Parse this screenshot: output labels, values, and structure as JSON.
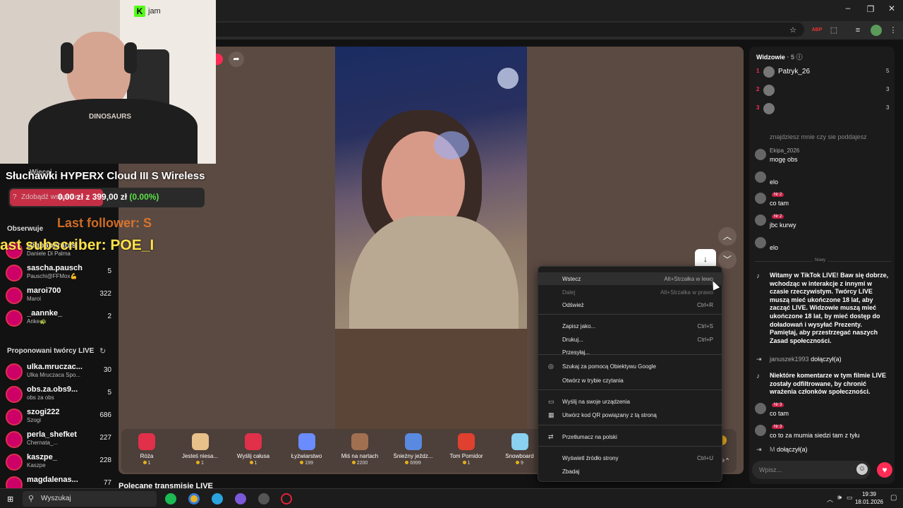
{
  "webcam": {
    "tag": "jam"
  },
  "overlay": {
    "product": "Słuchawki HYPERX Cloud III S Wireless",
    "ghost_text": "Wiecej",
    "progress_text": "0,00 zł z 399,00 zł",
    "progress_pct": "(0.00%)",
    "progress_fraction": 0.0,
    "support_button": "Zdobądź wsparcie",
    "last_follower": "Last follower: S",
    "last_subscriber": "ast subscriber: POE_I"
  },
  "sidebar": {
    "following_title": "Obserwuje",
    "following": [
      {
        "name": "Bigbabaratas",
        "sub": "Daniele Di Palma",
        "count": ""
      },
      {
        "name": "sascha.pausch",
        "sub": "Pauschi@FFMox💪",
        "count": "5"
      },
      {
        "name": "maroi700",
        "sub": "Maroi",
        "count": "322"
      },
      {
        "name": "_aannke_",
        "sub": "Anke🐢",
        "count": "2"
      }
    ],
    "suggested_title": "Proponowani twórcy LIVE",
    "suggested": [
      {
        "name": "ulka.mruczac...",
        "sub": "Ulka Mruczaca Spo...",
        "count": "30"
      },
      {
        "name": "obs.za.obs9...",
        "sub": "obs za obs",
        "count": "5"
      },
      {
        "name": "szogi222",
        "sub": "Szogi",
        "count": "686"
      },
      {
        "name": "perla_shefket",
        "sub": "Chernata_...",
        "count": "227"
      },
      {
        "name": "kaszpe_",
        "sub": "Kaszpe",
        "count": "228"
      },
      {
        "name": "magdalenas...",
        "sub": "",
        "count": "77"
      }
    ]
  },
  "page": {
    "recommended_title": "Polecane transmisje LIVE",
    "more_label": "ge ^"
  },
  "gifts": [
    {
      "name": "Róża",
      "price": "1",
      "color": "#e0304a"
    },
    {
      "name": "Jesteś niesa...",
      "price": "1",
      "color": "#e8c08a"
    },
    {
      "name": "Wyślij całusa",
      "price": "1",
      "color": "#e0304a"
    },
    {
      "name": "Łyżwiarstwo",
      "price": "199",
      "color": "#6a8cff"
    },
    {
      "name": "Miś na nartach",
      "price": "2200",
      "color": "#a07050"
    },
    {
      "name": "Śnieżny jeźdz...",
      "price": "6999",
      "color": "#5a8ae0"
    },
    {
      "name": "Tom Pomidor",
      "price": "1",
      "color": "#e04030"
    },
    {
      "name": "Snowboard",
      "price": "9",
      "color": "#8ad0f0"
    }
  ],
  "context_menu": {
    "items": [
      {
        "label": "Wstecz",
        "shortcut": "Alt+Strzałka w lewo",
        "icon": "",
        "state": "hover"
      },
      {
        "label": "Dalej",
        "shortcut": "Alt+Strzałka w prawo",
        "icon": "",
        "state": "disabled"
      },
      {
        "label": "Odśwież",
        "shortcut": "Ctrl+R",
        "icon": "",
        "state": ""
      },
      {
        "label": "Zapisz jako...",
        "shortcut": "Ctrl+S",
        "icon": "",
        "state": ""
      },
      {
        "label": "Drukuj...",
        "shortcut": "Ctrl+P",
        "icon": "",
        "state": ""
      },
      {
        "label": "Przesyłaj...",
        "shortcut": "",
        "icon": "",
        "state": ""
      },
      {
        "label": "Szukaj za pomocą Obiektywu Google",
        "shortcut": "",
        "icon": "◎",
        "state": ""
      },
      {
        "label": "Otwórz w trybie czytania",
        "shortcut": "",
        "icon": "",
        "state": ""
      },
      {
        "label": "Wyślij na swoje urządzenia",
        "shortcut": "",
        "icon": "▭",
        "state": ""
      },
      {
        "label": "Utwórz kod QR powiązany z tą stroną",
        "shortcut": "",
        "icon": "▦",
        "state": ""
      },
      {
        "label": "Przetłumacz na polski",
        "shortcut": "",
        "icon": "⇄",
        "state": ""
      },
      {
        "label": "Wyświetl źródło strony",
        "shortcut": "Ctrl+U",
        "icon": "",
        "state": ""
      },
      {
        "label": "Zbadaj",
        "shortcut": "",
        "icon": "",
        "state": ""
      }
    ]
  },
  "chat": {
    "viewers_title": "Widzowie",
    "viewers_sep": "·",
    "viewers_count": "5",
    "top_viewers": [
      {
        "rank": "1",
        "name": "Patryk_26",
        "count": "5"
      },
      {
        "rank": "2",
        "name": "",
        "count": "3"
      },
      {
        "rank": "3",
        "name": "",
        "count": "3"
      }
    ],
    "cut_text": "znajdziesz mnie czy sie poddajesz",
    "messages": [
      {
        "user": "Ekipa_2026",
        "badge": "",
        "text": "mogę obs"
      },
      {
        "user": "",
        "badge": "",
        "text": "elo"
      },
      {
        "user": "",
        "badge": "Nr 2",
        "text": "co tam"
      },
      {
        "user": "",
        "badge": "Nr 2",
        "text": "jbc kurwy"
      },
      {
        "user": "",
        "badge": "",
        "text": "elo"
      }
    ],
    "divider": "Nowy",
    "system_welcome": "Witamy w TikTok LIVE! Baw się dobrze, wchodząc w interakcje z innymi w czasie rzeczywistym. Twórcy LIVE muszą mieć ukończone 18 lat, aby zacząć LIVE. Widzowie muszą mieć ukończone 18 lat, by mieć dostęp do doładowań i wysyłać Prezenty. Pamiętaj, aby przestrzegać naszych Zasad społeczności.",
    "join1_user": "januszek1993",
    "join1_text": "dołączył(a)",
    "system_filter": "Niektóre komentarze w tym filmie LIVE zostały odfiltrowane, by chronić wrażenia członków społeczności.",
    "messages2": [
      {
        "badge": "Nr 3",
        "text": "co tam"
      },
      {
        "badge": "Nr 3",
        "text": "co to za mumia siedzi tam z tyłu"
      }
    ],
    "join2_user": "M",
    "join2_text": "dołączył(a)",
    "input_placeholder": "Wpisz..."
  },
  "taskbar": {
    "search_label": "Wyszukaj",
    "time": "19:39",
    "date": "18.01.2026"
  },
  "colors": {
    "accent": "#fe2c55",
    "stage": "#5b4a42",
    "chat_bg": "#1b1b1b"
  }
}
